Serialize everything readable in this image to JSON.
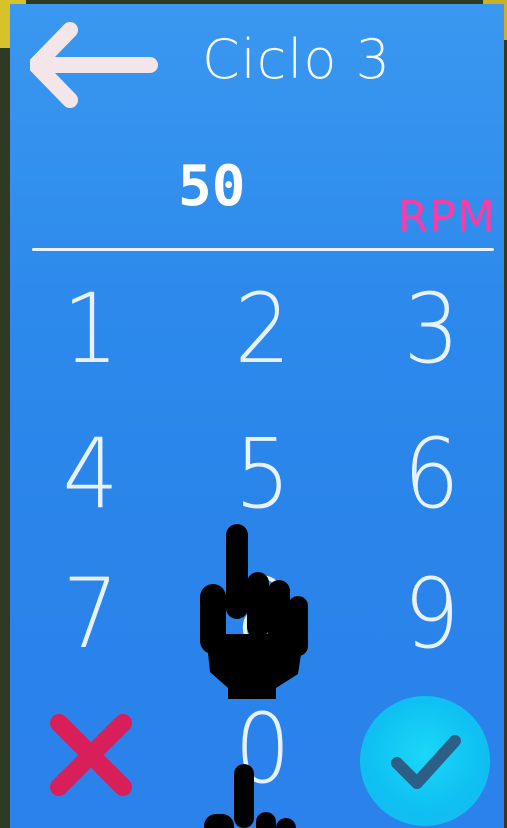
{
  "header": {
    "title": "Ciclo 3",
    "back_icon": "arrow-left-icon"
  },
  "input": {
    "value": "50",
    "unit": "RPM"
  },
  "keypad": {
    "keys": [
      "1",
      "2",
      "3",
      "4",
      "5",
      "6",
      "7",
      "8",
      "9",
      "0"
    ],
    "cancel_icon": "x-icon",
    "confirm_icon": "check-icon"
  },
  "colors": {
    "background": "#2d8aec",
    "unit": "#ff3aa6",
    "cancel": "#d81f5a",
    "confirm": "#0fc1f2"
  }
}
